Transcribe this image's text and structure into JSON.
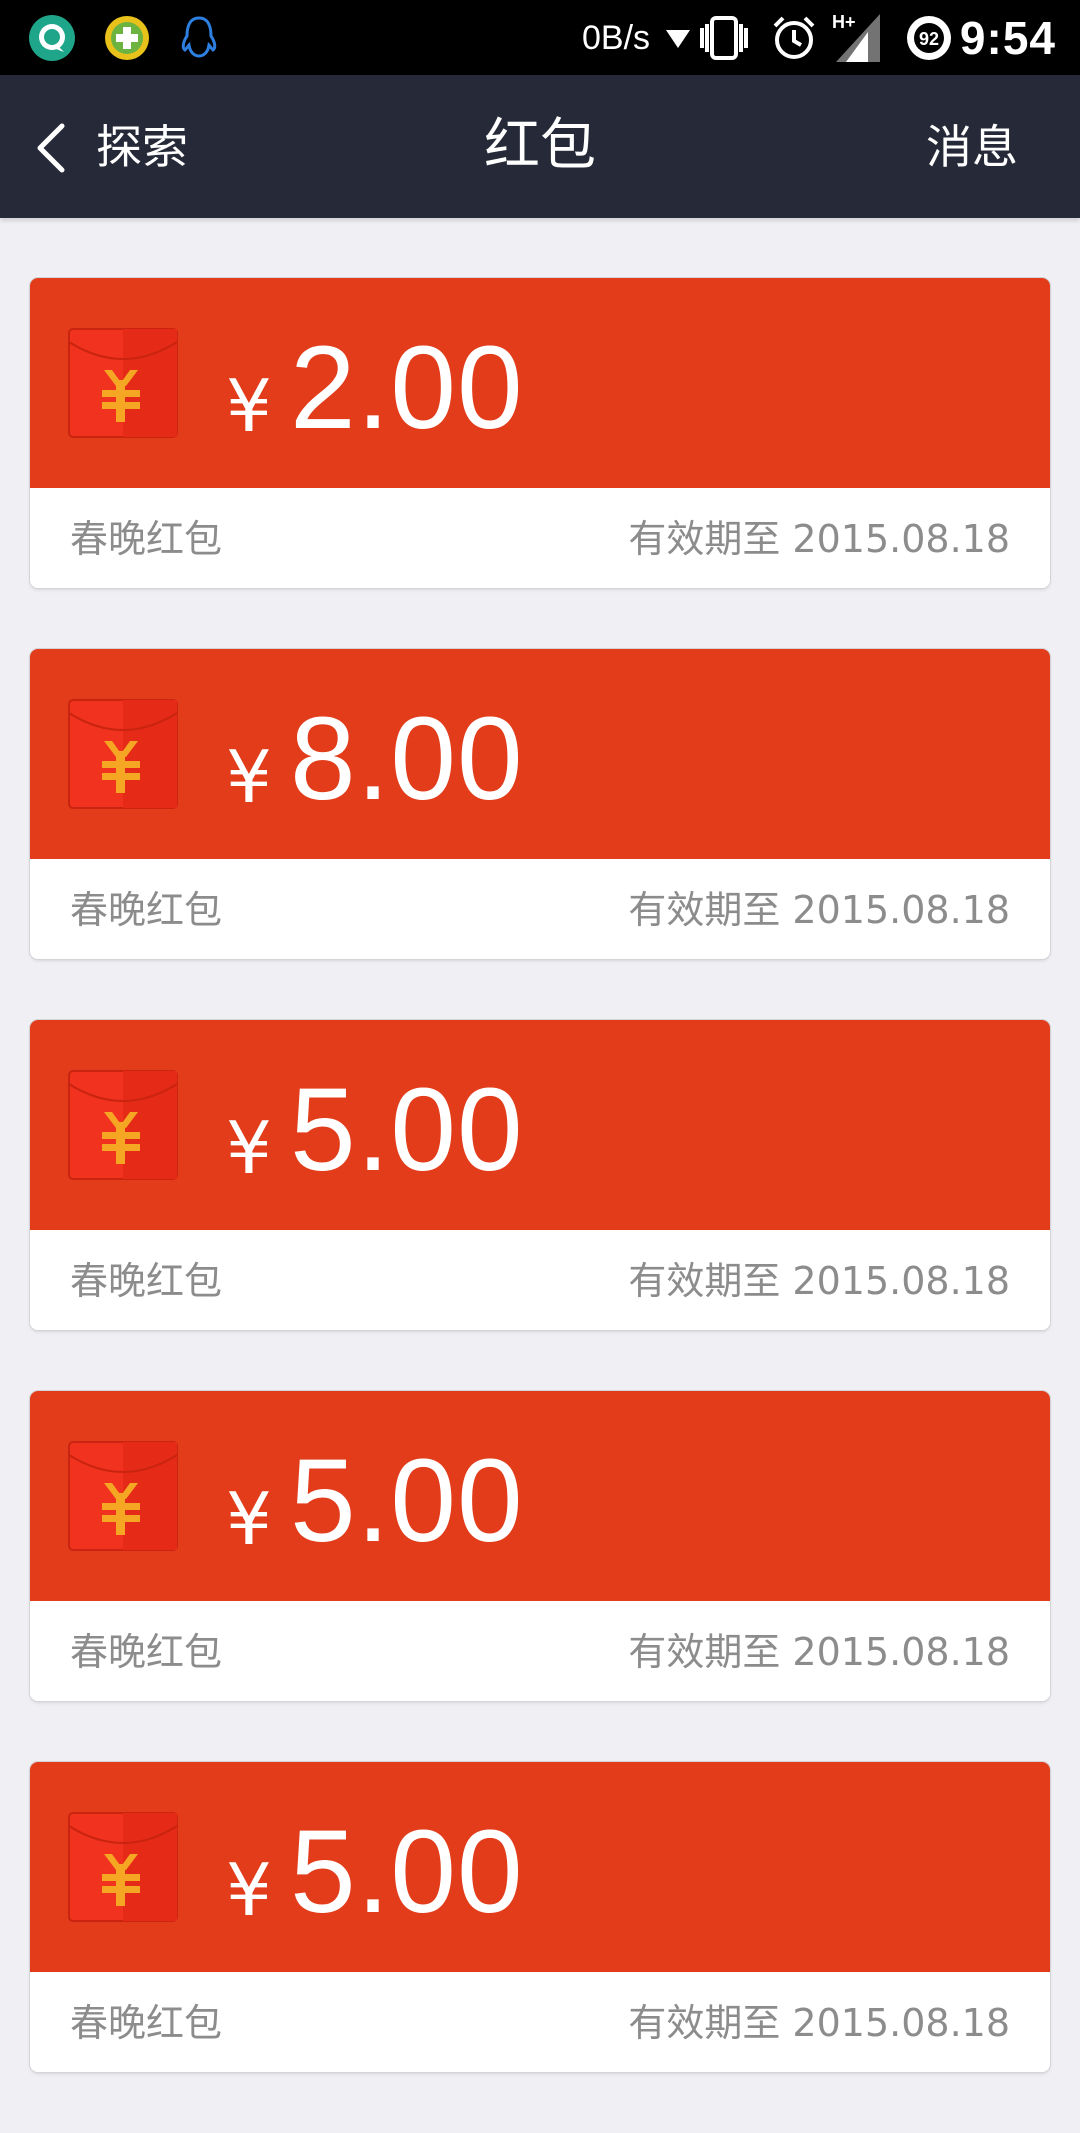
{
  "status_bar": {
    "net_speed": "0B/s",
    "battery_level": "92",
    "time": "9:54",
    "icons": [
      "chat-app-icon",
      "plus-app-icon",
      "qq-penguin-icon",
      "download-arrow-icon",
      "vibrate-icon",
      "alarm-icon",
      "hplus-signal-icon",
      "battery-icon"
    ]
  },
  "nav": {
    "back_label": "探索",
    "title": "红包",
    "right_label": "消息"
  },
  "colors": {
    "card_red": "#e23c1b",
    "nav_bg": "#262a38",
    "page_bg": "#efeff4",
    "label_gray": "#8c8c8c",
    "envelope_red": "#f0321f",
    "yen_gold": "#f5a623"
  },
  "currency_symbol": "¥",
  "red_packets": [
    {
      "amount": "2.00",
      "label": "春晚红包",
      "expiry": "有效期至 2015.08.18"
    },
    {
      "amount": "8.00",
      "label": "春晚红包",
      "expiry": "有效期至 2015.08.18"
    },
    {
      "amount": "5.00",
      "label": "春晚红包",
      "expiry": "有效期至 2015.08.18"
    },
    {
      "amount": "5.00",
      "label": "春晚红包",
      "expiry": "有效期至 2015.08.18"
    },
    {
      "amount": "5.00",
      "label": "春晚红包",
      "expiry": "有效期至 2015.08.18"
    }
  ]
}
